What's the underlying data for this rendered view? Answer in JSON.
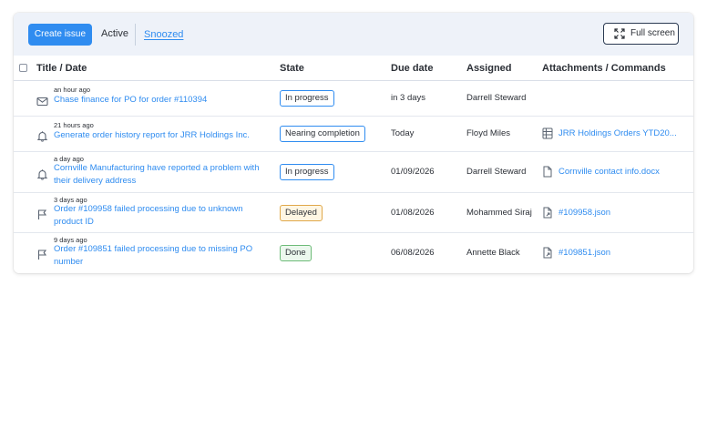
{
  "toolbar": {
    "create_label": "Create issue",
    "tab_active": "Active",
    "tab_snoozed": "Snoozed",
    "fullscreen_label": "Full screen"
  },
  "columns": {
    "title": "Title / Date",
    "state": "State",
    "due": "Due date",
    "assigned": "Assigned",
    "attachments": "Attachments / Commands"
  },
  "colors": {
    "accent": "#2f8cf0",
    "header_bg": "#eef2f9"
  },
  "rows": [
    {
      "icon": "mail-icon",
      "time": "an hour ago",
      "title": "Chase finance for PO for order #110394",
      "state": "In progress",
      "due": "in 3 days",
      "assigned": "Darrell Steward",
      "attachment": "",
      "attachment_icon": ""
    },
    {
      "icon": "bell-icon",
      "time": "21 hours ago",
      "title": "Generate order history report for JRR Holdings Inc.",
      "state": "Nearing completion",
      "due": "Today",
      "assigned": "Floyd Miles",
      "attachment": "JRR Holdings Orders YTD20...",
      "attachment_icon": "spreadsheet-icon"
    },
    {
      "icon": "bell-icon",
      "time": "a day ago",
      "title": "Cornville Manufacturing have reported a problem with their delivery address",
      "state": "In progress",
      "due": "01/09/2026",
      "assigned": "Darrell Steward",
      "attachment": "Cornville contact info.docx",
      "attachment_icon": "document-icon"
    },
    {
      "icon": "flag-icon",
      "time": "3 days ago",
      "title": "Order #109958 failed processing due to unknown product ID",
      "state": "Delayed",
      "due": "01/08/2026",
      "assigned": "Mohammed Siraj",
      "attachment": "#109958.json",
      "attachment_icon": "file-link-icon"
    },
    {
      "icon": "flag-icon",
      "time": "9 days ago",
      "title": "Order #109851 failed processing due to missing PO number",
      "state": "Done",
      "due": "06/08/2026",
      "assigned": "Annette Black",
      "attachment": "#109851.json",
      "attachment_icon": "file-link-icon"
    }
  ]
}
